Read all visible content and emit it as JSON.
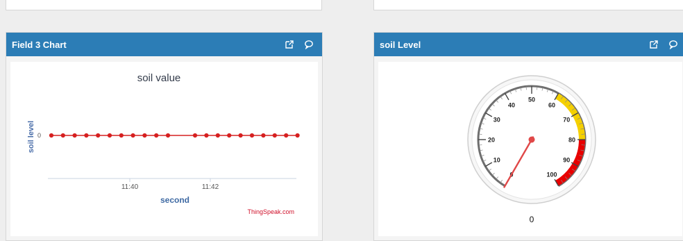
{
  "widgets": {
    "left": {
      "header_title": "Field 3 Chart",
      "icons": [
        "external-link-icon",
        "comment-icon"
      ]
    },
    "right": {
      "header_title": "soil Level",
      "icons": [
        "external-link-icon",
        "comment-icon"
      ]
    }
  },
  "chart_data": {
    "type": "line",
    "title": "soil value",
    "xlabel": "second",
    "ylabel": "soil level",
    "x_ticks": [
      "11:40",
      "11:42"
    ],
    "y_ticks": [
      "0"
    ],
    "series": [
      {
        "values": [
          0,
          0,
          0,
          0,
          0,
          0,
          0,
          0,
          0,
          0,
          0,
          0,
          0,
          0,
          0,
          0,
          0,
          0,
          0,
          0,
          0
        ]
      }
    ],
    "credit": "ThingSpeak.com",
    "color": "#d62020",
    "grid": false
  },
  "gauge": {
    "min": 0,
    "max": 100,
    "value": 0,
    "value_label": "0",
    "ticks": [
      "0",
      "10",
      "20",
      "30",
      "40",
      "50",
      "60",
      "70",
      "80",
      "90",
      "100"
    ],
    "bands": [
      {
        "from": 60,
        "to": 80,
        "color": "#f5d000"
      },
      {
        "from": 80,
        "to": 100,
        "color": "#e80000"
      }
    ]
  }
}
